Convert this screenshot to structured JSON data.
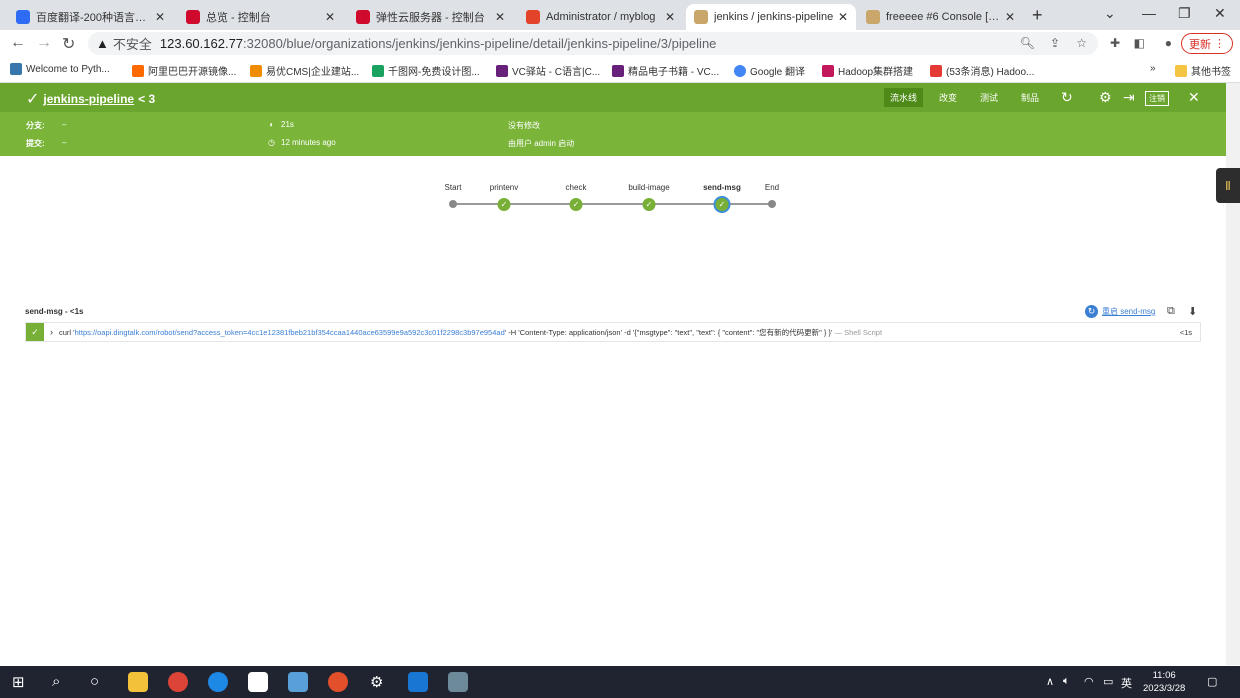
{
  "browser": {
    "tabs": [
      {
        "title": "百度翻译-200种语言互译、",
        "icon": "baidu-translate-icon",
        "color": "#2f6cf6"
      },
      {
        "title": "总览 - 控制台",
        "icon": "huawei-icon",
        "color": "#cf0a2c"
      },
      {
        "title": "弹性云服务器 - 控制台",
        "icon": "huawei-icon",
        "color": "#cf0a2c"
      },
      {
        "title": "Administrator / myblog",
        "icon": "gitlab-icon",
        "color": "#e24329"
      },
      {
        "title": "jenkins / jenkins-pipeline",
        "icon": "jenkins-icon",
        "color": "#c9a76b"
      },
      {
        "title": "freeeee #6 Console [Jenk",
        "icon": "jenkins-icon",
        "color": "#c9a76b"
      }
    ],
    "insecure_label": "不安全",
    "url_host": "123.60.162.77",
    "url_rest": ":32080/blue/organizations/jenkins/jenkins-pipeline/detail/jenkins-pipeline/3/pipeline",
    "update_label": "更新",
    "bookmarks": [
      {
        "label": "Welcome to Pyth...",
        "color": "#3776ab"
      },
      {
        "label": "阿里巴巴开源镜像...",
        "color": "#ff6a00"
      },
      {
        "label": "易优CMS|企业建站...",
        "color": "#f08c00"
      },
      {
        "label": "千图网-免费设计图...",
        "color": "#1aa260"
      },
      {
        "label": "VC驿站 - C语言|C...",
        "color": "#68217a"
      },
      {
        "label": "精品电子书籍 - VC...",
        "color": "#68217a"
      },
      {
        "label": "Google 翻译",
        "color": "#4285f4"
      },
      {
        "label": "Hadoop集群搭建",
        "color": "#c2185b"
      },
      {
        "label": "(53条消息) Hadoo...",
        "color": "#e53935"
      }
    ],
    "other_bookmarks": "其他书签"
  },
  "jenkins": {
    "pipeline_name": "jenkins-pipeline",
    "run_sep": "<",
    "run_number": "3",
    "nav": [
      "流水线",
      "改变",
      "测试",
      "制品"
    ],
    "logout": "注销",
    "branch_label": "分支:",
    "branch_value": "–",
    "commit_label": "提交:",
    "commit_value": "–",
    "duration": "21s",
    "time_ago": "12 minutes ago",
    "changes": "没有修改",
    "started_by": "由用户 admin 启动",
    "stages": [
      {
        "name": "Start",
        "state": "start"
      },
      {
        "name": "printenv",
        "state": "success"
      },
      {
        "name": "check",
        "state": "success"
      },
      {
        "name": "build-image",
        "state": "success"
      },
      {
        "name": "send-msg",
        "state": "selected"
      },
      {
        "name": "End",
        "state": "end"
      }
    ],
    "step_title": "send-msg - <1s",
    "restart_label": "重启 send-msg",
    "step": {
      "cmd_prefix": "curl '",
      "cmd_url": "https://oapi.dingtalk.com/robot/send?access_token=4cc1e12381fbeb21bf354ccaa1440ace63599e9a592c3c01f2298c3b97e954ad",
      "cmd_suffix": "' -H 'Content-Type: application/json' -d '{\"msgtype\": \"text\", \"text\": { \"content\": \"您有新的代码更新\" } }'",
      "type": " — Shell Script",
      "duration": "<1s"
    }
  },
  "taskbar": {
    "ime": "英",
    "time": "11:06",
    "date": "2023/3/28"
  }
}
